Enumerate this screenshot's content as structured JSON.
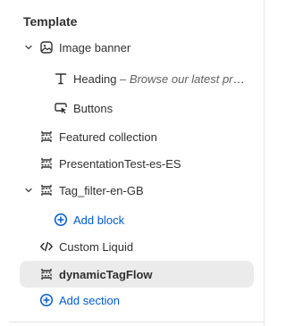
{
  "sidebar": {
    "section_title": "Template",
    "items": [
      {
        "label": "Image banner",
        "icon": "image-icon",
        "expanded": true
      },
      {
        "label": "Heading",
        "separator": " – ",
        "subtitle": "Browse our latest pro...",
        "icon": "text-icon"
      },
      {
        "label": "Buttons",
        "icon": "button-pointer-icon"
      },
      {
        "label": "Featured collection",
        "icon": "section-icon"
      },
      {
        "label": "PresentationTest-es-ES",
        "icon": "section-icon"
      },
      {
        "label": "Tag_filter-en-GB",
        "icon": "section-icon",
        "expanded": true
      },
      {
        "label": "Add block",
        "icon": "plus-circle-icon"
      },
      {
        "label": "Custom Liquid",
        "icon": "code-icon"
      },
      {
        "label": "dynamicTagFlow",
        "icon": "section-icon",
        "selected": true
      },
      {
        "label": "Add section",
        "icon": "plus-circle-icon"
      }
    ]
  },
  "colors": {
    "accent": "#005bd3",
    "text": "#303030",
    "selected_bg": "#ebebeb",
    "border": "#e3e3e3"
  }
}
